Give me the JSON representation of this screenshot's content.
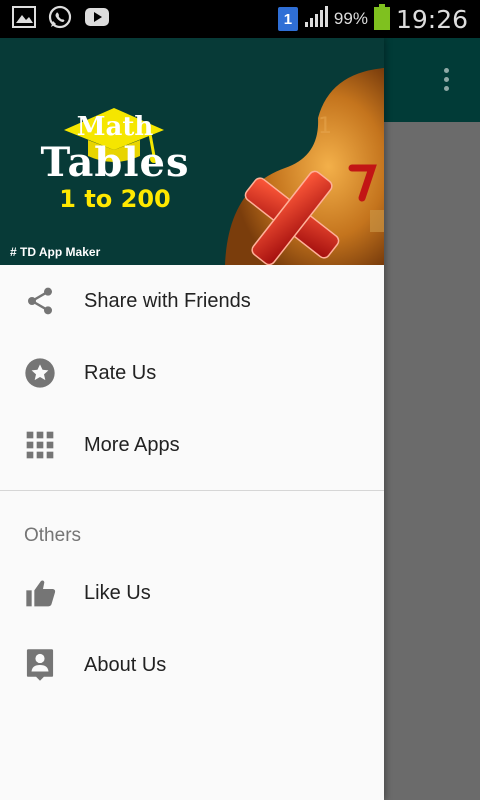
{
  "status_bar": {
    "sim_slot": "1",
    "battery_percent": "99%",
    "time": "19:26",
    "icons": [
      "image-icon",
      "whatsapp-icon",
      "youtube-icon"
    ]
  },
  "banner": {
    "title_line1": "Math",
    "title_line2": "Tables",
    "title_line3": "1 to 200",
    "maker": "# TD App Maker"
  },
  "drawer": {
    "primary_items": [
      {
        "label": "Share with Friends",
        "icon": "share-icon"
      },
      {
        "label": "Rate Us",
        "icon": "star-icon"
      },
      {
        "label": "More Apps",
        "icon": "apps-grid-icon"
      }
    ],
    "section_title": "Others",
    "secondary_items": [
      {
        "label": "Like Us",
        "icon": "thumb-up-icon"
      },
      {
        "label": "About Us",
        "icon": "contact-card-icon"
      }
    ]
  },
  "colors": {
    "appbar": "#013b37",
    "banner_bg": "#073a37",
    "icon_gray": "#757575",
    "accent_yellow": "#ffe800"
  }
}
